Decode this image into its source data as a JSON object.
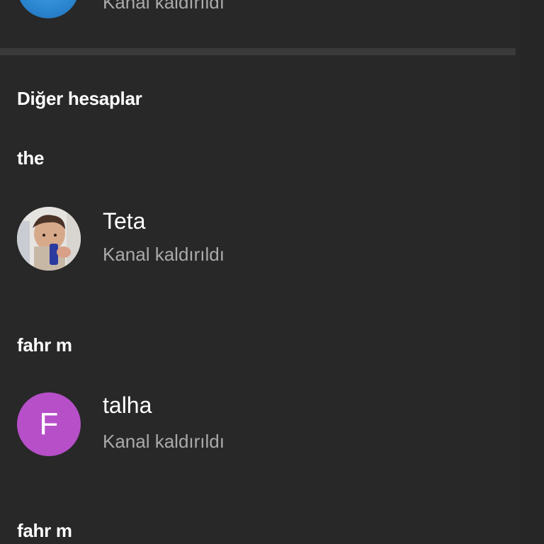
{
  "top_account": {
    "subtitle": "Kanal kaldırıldı"
  },
  "section": {
    "title": "Diğer hesaplar"
  },
  "accounts": [
    {
      "email": "the",
      "channels": [
        {
          "name": "Teta",
          "subtitle": "Kanal kaldırıldı",
          "avatar": "photo"
        }
      ]
    },
    {
      "email": "fahr                                  m",
      "channels": [
        {
          "name": "               talha",
          "subtitle": "Kanal kaldırıldı",
          "avatar": "letter",
          "avatar_letter": "F",
          "avatar_color": "#b64fc8"
        }
      ]
    },
    {
      "email": "fahr                                   m"
    }
  ],
  "colors": {
    "background": "#282828",
    "divider": "#3a3a3a",
    "primary_text": "#ffffff",
    "secondary_text": "#aaaaaa"
  }
}
